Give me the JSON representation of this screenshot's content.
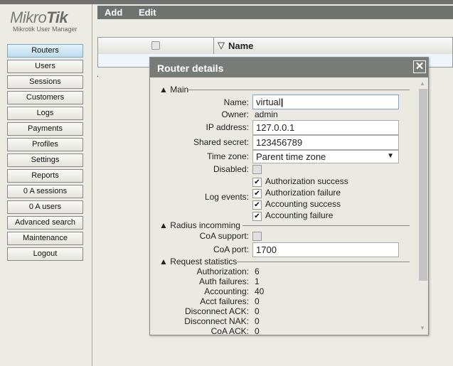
{
  "logo": {
    "brand_light": "Mikro",
    "brand_bold": "Tik",
    "subtitle": "Mikrotik User Manager"
  },
  "sidebar": {
    "items": [
      {
        "label": "Routers",
        "active": true
      },
      {
        "label": "Users"
      },
      {
        "label": "Sessions"
      },
      {
        "label": "Customers"
      },
      {
        "label": "Logs"
      },
      {
        "label": "Payments"
      },
      {
        "label": "Profiles"
      },
      {
        "label": "Settings"
      },
      {
        "label": "Reports"
      },
      {
        "label": "0 A sessions"
      },
      {
        "label": "0 A users"
      },
      {
        "label": "Advanced search"
      },
      {
        "label": "Maintenance"
      },
      {
        "label": "Logout"
      }
    ]
  },
  "toolbar": {
    "add": "Add",
    "edit": "Edit"
  },
  "table": {
    "sort_icon": "▽",
    "name_header": "Name",
    "footer_text": "."
  },
  "dialog": {
    "title": "Router details",
    "close": "✕",
    "main": {
      "section": "Main",
      "name_label": "Name:",
      "name": "virtual",
      "owner_label": "Owner:",
      "owner": "admin",
      "ip_label": "IP address:",
      "ip": "127.0.0.1",
      "secret_label": "Shared secret:",
      "secret": "123456789",
      "tz_label": "Time zone:",
      "tz": "Parent time zone",
      "disabled_label": "Disabled:",
      "log_label": "Log events:",
      "log_events": [
        {
          "label": "Authorization success",
          "checked": true
        },
        {
          "label": "Authorization failure",
          "checked": true
        },
        {
          "label": "Accounting success",
          "checked": true
        },
        {
          "label": "Accounting failure",
          "checked": true
        }
      ]
    },
    "radius": {
      "section": "Radius incomming",
      "coa_support_label": "CoA support:",
      "coa_port_label": "CoA port:",
      "coa_port": "1700"
    },
    "stats": {
      "section": "Request statistics",
      "rows": [
        {
          "label": "Authorization:",
          "value": "6"
        },
        {
          "label": "Auth failures:",
          "value": "1"
        },
        {
          "label": "Accounting:",
          "value": "40"
        },
        {
          "label": "Acct failures:",
          "value": "0"
        },
        {
          "label": "Disconnect ACK:",
          "value": "0"
        },
        {
          "label": "Disconnect NAK:",
          "value": "0"
        },
        {
          "label": "CoA ACK:",
          "value": "0"
        }
      ]
    }
  }
}
